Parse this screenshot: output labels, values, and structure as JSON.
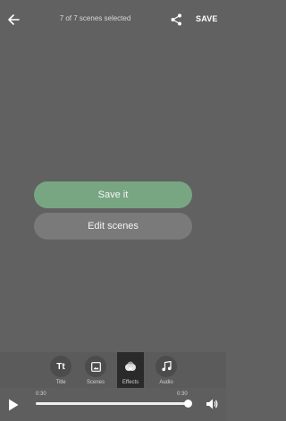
{
  "header": {
    "title": "7 of 7 scenes selected",
    "save_label": "SAVE"
  },
  "actions": {
    "save_it": "Save it",
    "edit_scenes": "Edit scenes"
  },
  "toolbar": {
    "items": [
      {
        "label": "Title",
        "icon": "title-icon"
      },
      {
        "label": "Scenes",
        "icon": "image-icon"
      },
      {
        "label": "Effects",
        "icon": "effects-icon",
        "active": true
      },
      {
        "label": "Audio",
        "icon": "music-note-icon"
      }
    ]
  },
  "player": {
    "current_time": "0:30",
    "total_time": "0:30",
    "progress": 1.0
  },
  "colors": {
    "background": "#616161",
    "save_button": "#78a683",
    "edit_button": "#7a7a7a"
  }
}
